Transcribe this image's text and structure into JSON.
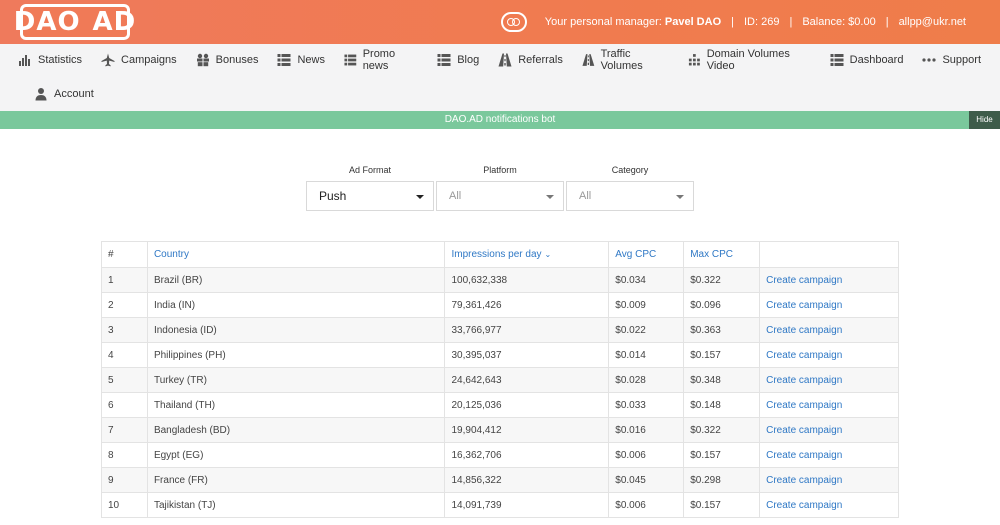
{
  "header": {
    "logo_left": "DAO",
    "logo_right": "AD",
    "manager_label": "Your personal manager:",
    "manager_name": "Pavel DAO",
    "id_text": "ID: 269",
    "balance_text": "Balance: $0.00",
    "email": "allpp@ukr.net",
    "separator": "|"
  },
  "nav": {
    "row1": [
      {
        "label": "Statistics",
        "icon": "bar-chart-icon"
      },
      {
        "label": "Campaigns",
        "icon": "plane-icon"
      },
      {
        "label": "Bonuses",
        "icon": "gift-icon"
      },
      {
        "label": "News",
        "icon": "list-icon"
      },
      {
        "label": "Promo news",
        "icon": "list-icon"
      },
      {
        "label": "Blog",
        "icon": "list-icon"
      },
      {
        "label": "Referrals",
        "icon": "road-icon"
      },
      {
        "label": "Traffic Volumes",
        "icon": "road-icon"
      },
      {
        "label": "Domain Volumes Video",
        "icon": "grid-icon"
      },
      {
        "label": "Dashboard",
        "icon": "list-icon"
      },
      {
        "label": "Support",
        "icon": "dots-icon"
      }
    ],
    "row2": [
      {
        "label": "Account",
        "icon": "user-icon"
      }
    ]
  },
  "notification": {
    "text": "DAO.AD notifications bot",
    "hide_label": "Hide"
  },
  "filters": {
    "ad_format": {
      "label": "Ad Format",
      "value": "Push"
    },
    "platform": {
      "label": "Platform",
      "value": "All"
    },
    "category": {
      "label": "Category",
      "value": "All"
    }
  },
  "table": {
    "headers": [
      "#",
      "Country",
      "Impressions per day",
      "Avg CPC",
      "Max CPC",
      ""
    ],
    "sort_indicator": "⌄",
    "rows": [
      {
        "n": "1",
        "country": "Brazil (BR)",
        "impressions": "100,632,338",
        "avg": "$0.034",
        "max": "$0.322",
        "action": "Create campaign"
      },
      {
        "n": "2",
        "country": "India (IN)",
        "impressions": "79,361,426",
        "avg": "$0.009",
        "max": "$0.096",
        "action": "Create campaign"
      },
      {
        "n": "3",
        "country": "Indonesia (ID)",
        "impressions": "33,766,977",
        "avg": "$0.022",
        "max": "$0.363",
        "action": "Create campaign"
      },
      {
        "n": "4",
        "country": "Philippines (PH)",
        "impressions": "30,395,037",
        "avg": "$0.014",
        "max": "$0.157",
        "action": "Create campaign"
      },
      {
        "n": "5",
        "country": "Turkey (TR)",
        "impressions": "24,642,643",
        "avg": "$0.028",
        "max": "$0.348",
        "action": "Create campaign"
      },
      {
        "n": "6",
        "country": "Thailand (TH)",
        "impressions": "20,125,036",
        "avg": "$0.033",
        "max": "$0.148",
        "action": "Create campaign"
      },
      {
        "n": "7",
        "country": "Bangladesh (BD)",
        "impressions": "19,904,412",
        "avg": "$0.016",
        "max": "$0.322",
        "action": "Create campaign"
      },
      {
        "n": "8",
        "country": "Egypt (EG)",
        "impressions": "16,362,706",
        "avg": "$0.006",
        "max": "$0.157",
        "action": "Create campaign"
      },
      {
        "n": "9",
        "country": "France (FR)",
        "impressions": "14,856,322",
        "avg": "$0.045",
        "max": "$0.298",
        "action": "Create campaign"
      },
      {
        "n": "10",
        "country": "Tajikistan (TJ)",
        "impressions": "14,091,739",
        "avg": "$0.006",
        "max": "$0.157",
        "action": "Create campaign"
      }
    ]
  }
}
